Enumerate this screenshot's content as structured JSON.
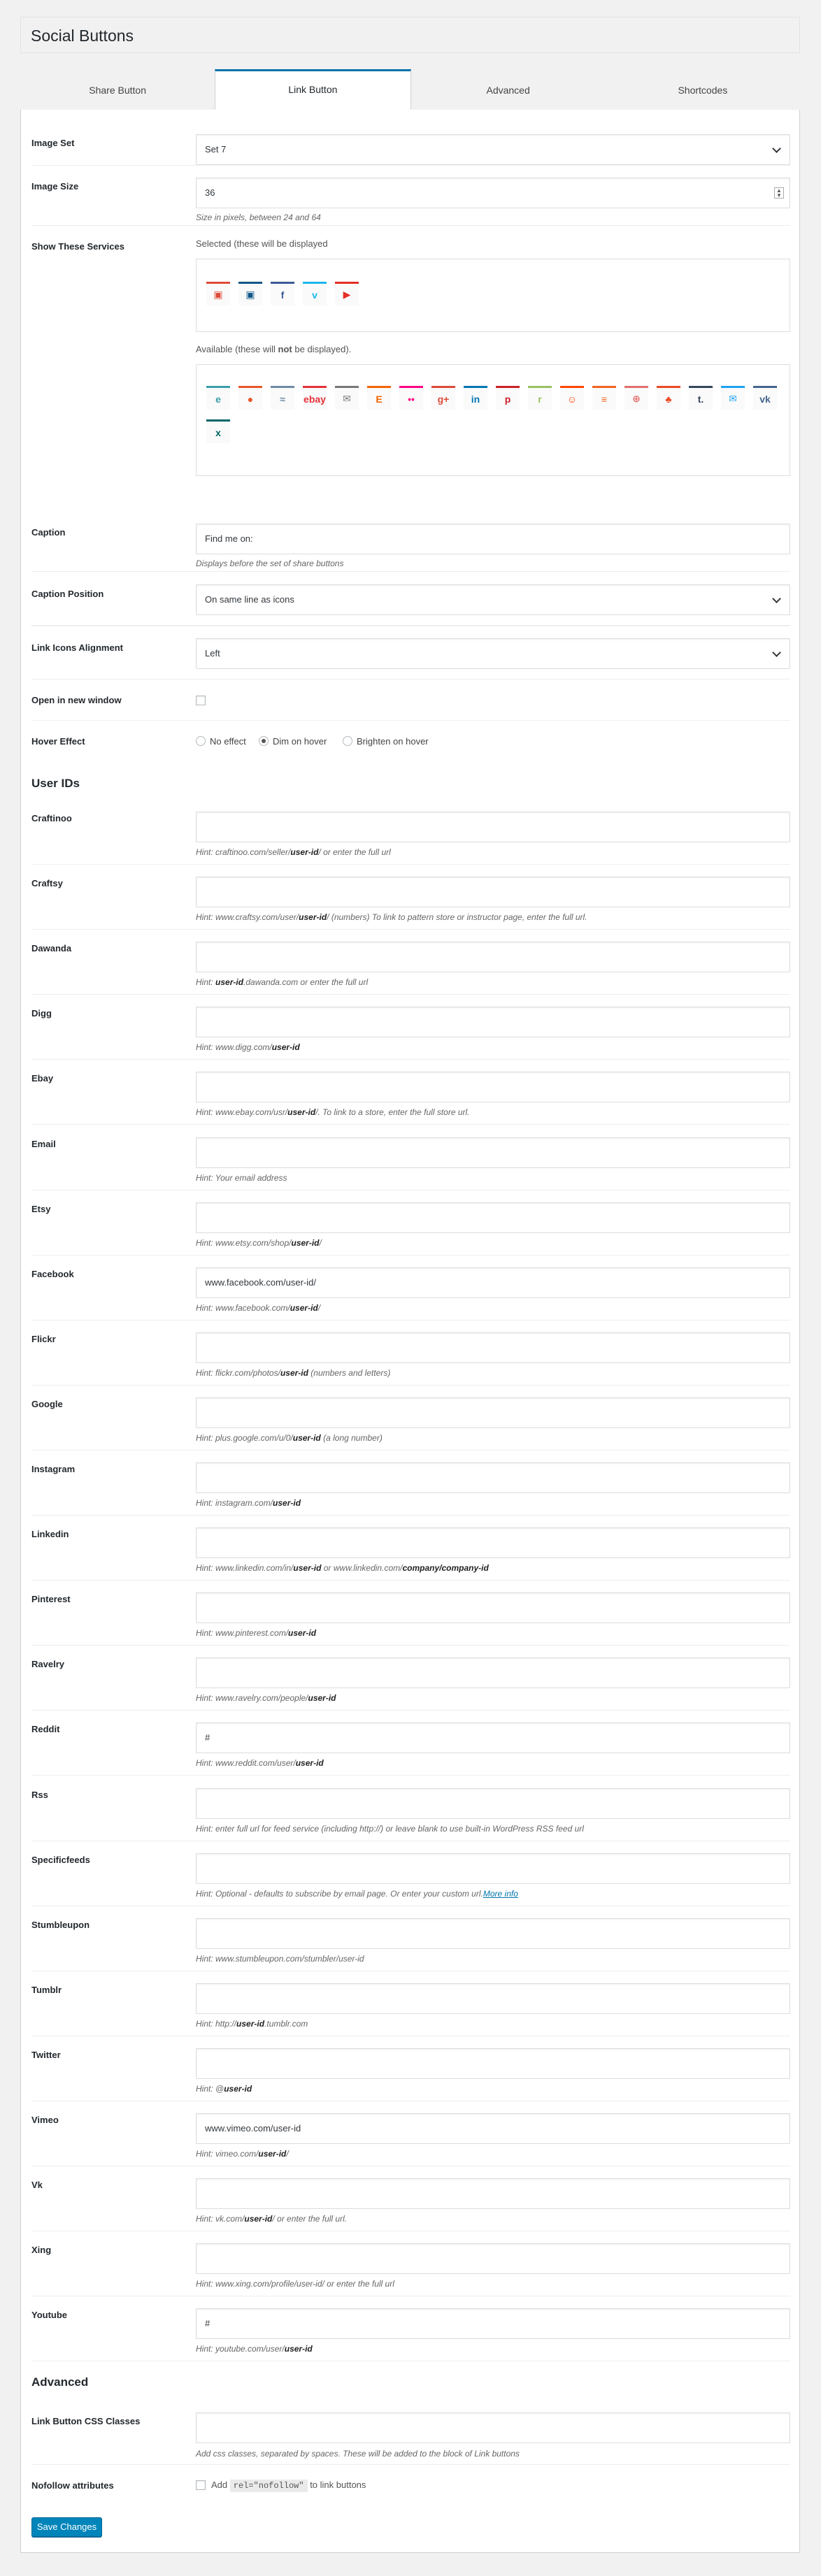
{
  "page_title": "Social Buttons",
  "tabs": [
    "Share Button",
    "Link Button",
    "Advanced",
    "Shortcodes"
  ],
  "active_tab": "Link Button",
  "image_set": {
    "label": "Image Set",
    "value": "Set 7"
  },
  "image_size": {
    "label": "Image Size",
    "value": "36",
    "hint": "Size in pixels, between 24 and 64"
  },
  "services": {
    "label": "Show These Services",
    "selected_label": "Selected (these will be displayed",
    "available_label_pre": "Available (these will ",
    "available_label_bold": "not",
    "available_label_post": " be displayed).",
    "selected": [
      {
        "name": "email-lock",
        "glyph": "▣",
        "color": "#dd4b39"
      },
      {
        "name": "instagram",
        "glyph": "▣",
        "color": "#125688"
      },
      {
        "name": "facebook",
        "glyph": "f",
        "color": "#3b5998"
      },
      {
        "name": "vimeo",
        "glyph": "v",
        "color": "#1ab7ea"
      },
      {
        "name": "youtube",
        "glyph": "▶",
        "color": "#e52d27"
      }
    ],
    "available": [
      {
        "name": "craftinoo",
        "glyph": "e",
        "color": "#39a0a9"
      },
      {
        "name": "craftsy",
        "glyph": "●",
        "color": "#e8572a"
      },
      {
        "name": "dawanda",
        "glyph": "≈",
        "color": "#6f8aa5"
      },
      {
        "name": "ebay",
        "glyph": "ebay",
        "color": "#e53238"
      },
      {
        "name": "email",
        "glyph": "✉",
        "color": "#777777"
      },
      {
        "name": "etsy",
        "glyph": "E",
        "color": "#f56400"
      },
      {
        "name": "flickr",
        "glyph": "••",
        "color": "#ff0084"
      },
      {
        "name": "google",
        "glyph": "g+",
        "color": "#dd4b39"
      },
      {
        "name": "linkedin",
        "glyph": "in",
        "color": "#0077b5"
      },
      {
        "name": "pinterest",
        "glyph": "p",
        "color": "#cb2027"
      },
      {
        "name": "ravelry",
        "glyph": "r",
        "color": "#9ac160"
      },
      {
        "name": "reddit",
        "glyph": "☺",
        "color": "#ff4500"
      },
      {
        "name": "rss",
        "glyph": "≡",
        "color": "#f26522"
      },
      {
        "name": "specificfeeds",
        "glyph": "⊕",
        "color": "#e46f6f"
      },
      {
        "name": "stumbleupon",
        "glyph": "♣",
        "color": "#eb4924"
      },
      {
        "name": "tumblr",
        "glyph": "t.",
        "color": "#35465c"
      },
      {
        "name": "twitter",
        "glyph": "✉",
        "color": "#1da1f2"
      },
      {
        "name": "vk",
        "glyph": "vk",
        "color": "#45668e"
      },
      {
        "name": "xing",
        "glyph": "x",
        "color": "#006567"
      }
    ]
  },
  "caption": {
    "label": "Caption",
    "value": "Find me on:",
    "hint": "Displays before the set of share buttons"
  },
  "caption_position": {
    "label": "Caption Position",
    "value": "On same line as icons"
  },
  "alignment": {
    "label": "Link Icons Alignment",
    "value": "Left"
  },
  "new_window": {
    "label": "Open in new window"
  },
  "hover_effect": {
    "label": "Hover Effect",
    "options": [
      "No effect",
      "Dim on hover",
      "Brighten on hover"
    ],
    "selected": "Dim on hover"
  },
  "user_ids_title": "User IDs",
  "user_ids": [
    {
      "label": "Craftinoo",
      "value": "",
      "hint_parts": [
        "Hint: craftinoo.com/seller/",
        "user-id",
        "/ or enter the full url"
      ]
    },
    {
      "label": "Craftsy",
      "value": "",
      "hint_parts": [
        "Hint: www.craftsy.com/user/",
        "user-id",
        "/ (numbers) To link to pattern store or instructor page, enter the full url."
      ]
    },
    {
      "label": "Dawanda",
      "value": "",
      "hint_parts": [
        "Hint: ",
        "user-id",
        ".dawanda.com or enter the full url"
      ]
    },
    {
      "label": "Digg",
      "value": "",
      "hint_parts": [
        "Hint: www.digg.com/",
        "user-id",
        ""
      ]
    },
    {
      "label": "Ebay",
      "value": "",
      "hint_parts": [
        "Hint: www.ebay.com/usr/",
        "user-id",
        "/. To link to a store, enter the full store url."
      ]
    },
    {
      "label": "Email",
      "value": "",
      "hint_parts": [
        "Hint: Your email address",
        "",
        ""
      ]
    },
    {
      "label": "Etsy",
      "value": "",
      "hint_parts": [
        "Hint: www.etsy.com/shop/",
        "user-id",
        "/"
      ]
    },
    {
      "label": "Facebook",
      "value": "www.facebook.com/user-id/",
      "hint_parts": [
        "Hint: www.facebook.com/",
        "user-id",
        "/"
      ]
    },
    {
      "label": "Flickr",
      "value": "",
      "hint_parts": [
        "Hint: flickr.com/photos/",
        "user-id",
        " (numbers and letters)"
      ]
    },
    {
      "label": "Google",
      "value": "",
      "hint_parts": [
        "Hint: plus.google.com/u/0/",
        "user-id",
        " (a long number)"
      ]
    },
    {
      "label": "Instagram",
      "value": "",
      "hint_parts": [
        "Hint: instagram.com/",
        "user-id",
        ""
      ]
    },
    {
      "label": "Linkedin",
      "value": "",
      "hint_parts": [
        "Hint: www.linkedin.com/in/",
        "user-id",
        " or www.linkedin.com/",
        "company/company-id"
      ]
    },
    {
      "label": "Pinterest",
      "value": "",
      "hint_parts": [
        "Hint: www.pinterest.com/",
        "user-id",
        ""
      ]
    },
    {
      "label": "Ravelry",
      "value": "",
      "hint_parts": [
        "Hint: www.ravelry.com/people/",
        "user-id",
        ""
      ]
    },
    {
      "label": "Reddit",
      "value": "#",
      "hint_parts": [
        "Hint: www.reddit.com/user/",
        "user-id",
        ""
      ]
    },
    {
      "label": "Rss",
      "value": "",
      "hint_parts": [
        "Hint: enter full url for feed service (including http://) or leave blank to use built-in WordPress RSS feed url",
        "",
        ""
      ]
    },
    {
      "label": "Specificfeeds",
      "value": "",
      "hint_parts": [
        "Hint: Optional - defaults to subscribe by email page. Or enter your custom url.",
        "",
        ""
      ],
      "link": "More info"
    },
    {
      "label": "Stumbleupon",
      "value": "",
      "hint_parts": [
        "Hint: www.stumbleupon.com/stumbler/user-id",
        "",
        ""
      ]
    },
    {
      "label": "Tumblr",
      "value": "",
      "hint_parts": [
        "Hint: http://",
        "user-id",
        ".tumblr.com"
      ]
    },
    {
      "label": "Twitter",
      "value": "",
      "hint_parts": [
        "Hint: @",
        "user-id",
        ""
      ]
    },
    {
      "label": "Vimeo",
      "value": "www.vimeo.com/user-id",
      "hint_parts": [
        "Hint: vimeo.com/",
        "user-id",
        "/"
      ]
    },
    {
      "label": "Vk",
      "value": "",
      "hint_parts": [
        "Hint: vk.com/",
        "user-id",
        "/ or enter the full url."
      ]
    },
    {
      "label": "Xing",
      "value": "",
      "hint_parts": [
        "Hint: www.xing.com/profile/user-id/ or enter the full url",
        "",
        ""
      ]
    },
    {
      "label": "Youtube",
      "value": "#",
      "hint_parts": [
        "Hint: youtube.com/user/",
        "user-id",
        ""
      ]
    }
  ],
  "advanced_title": "Advanced",
  "css_classes": {
    "label": "Link Button CSS Classes",
    "value": "",
    "hint": "Add css classes, separated by spaces. These will be added to the block of Link buttons"
  },
  "nofollow": {
    "label": "Nofollow attributes",
    "pre": "Add ",
    "code": "rel=\"nofollow\"",
    "post": " to link buttons"
  },
  "save_label": "Save Changes",
  "colors": {
    "accent": "#0073aa",
    "button": "#0085ba"
  }
}
